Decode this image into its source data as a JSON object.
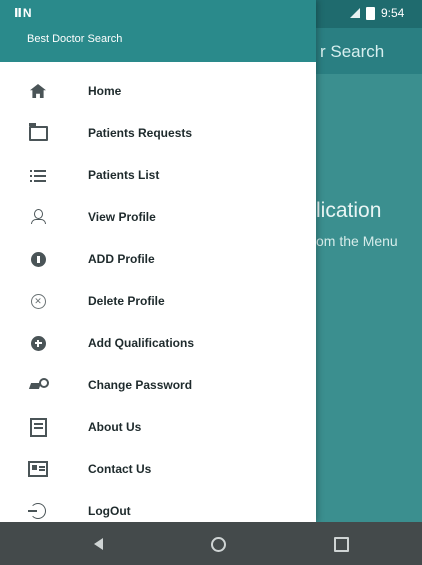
{
  "status_bar": {
    "left_text": "ⅡN",
    "time": "9:54"
  },
  "app": {
    "toolbar_title": "r Search",
    "heading": "lication",
    "subtext": "om the Menu"
  },
  "drawer": {
    "header_title": "Best Doctor Search",
    "items": [
      {
        "label": "Home",
        "icon": "home-icon"
      },
      {
        "label": "Patients Requests",
        "icon": "folder-icon"
      },
      {
        "label": "Patients List",
        "icon": "list-icon"
      },
      {
        "label": "View Profile",
        "icon": "person-icon"
      },
      {
        "label": "ADD Profile",
        "icon": "info-icon"
      },
      {
        "label": "Delete Profile",
        "icon": "cancel-icon"
      },
      {
        "label": "Add Qualifications",
        "icon": "add-circle-icon"
      },
      {
        "label": "Change Password",
        "icon": "key-icon"
      },
      {
        "label": "About Us",
        "icon": "book-icon"
      },
      {
        "label": "Contact Us",
        "icon": "contact-card-icon"
      },
      {
        "label": "LogOut",
        "icon": "logout-icon"
      }
    ]
  },
  "colors": {
    "primary": "#2a8a8b",
    "primary_dark": "#1f6b6e",
    "content_bg": "#3b8f8f",
    "navbar": "#444a4b"
  }
}
